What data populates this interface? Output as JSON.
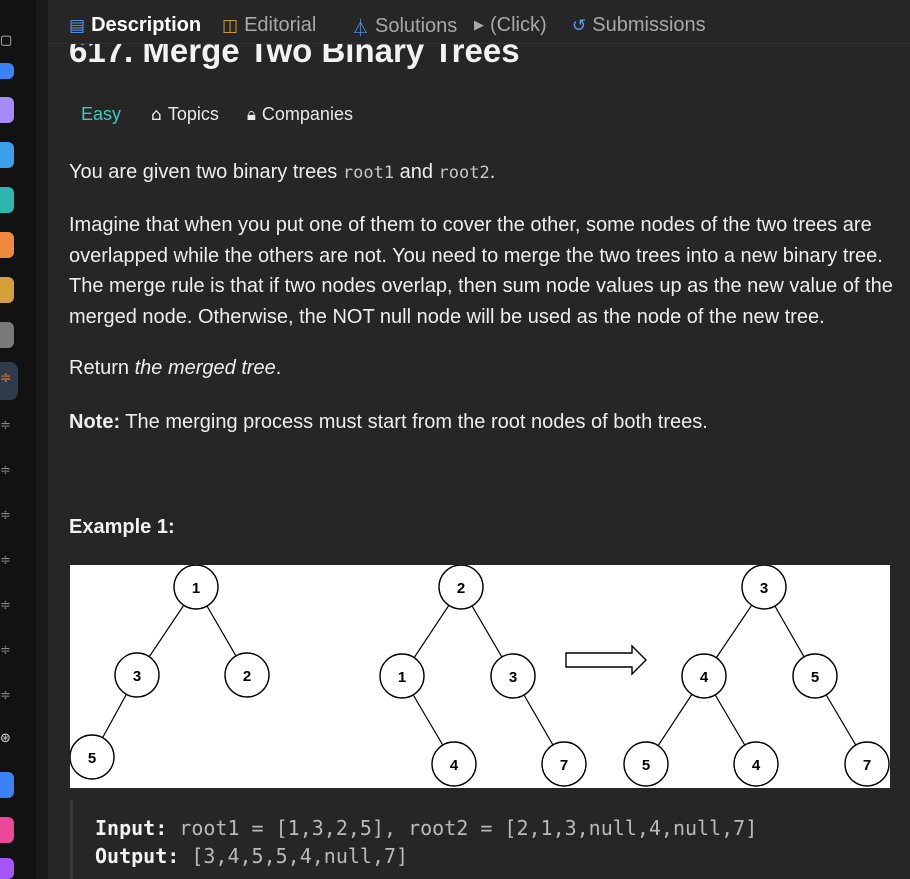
{
  "tabs": [
    {
      "label": "Description",
      "icon": "description-icon"
    },
    {
      "label": "Editorial",
      "icon": "book-icon"
    },
    {
      "label": "Solutions",
      "icon": "flask-icon"
    },
    {
      "label": "(Click)",
      "icon": "play-icon"
    },
    {
      "label": "Submissions",
      "icon": "history-icon"
    }
  ],
  "problem": {
    "title": "617. Merge Two Binary Trees",
    "difficulty": "Easy",
    "topics_label": "Topics",
    "companies_label": "Companies",
    "p1_prefix": "You are given two binary trees ",
    "p1_code1": "root1",
    "p1_mid": " and ",
    "p1_code2": "root2",
    "p1_end": ".",
    "p2": "Imagine that when you put one of them to cover the other, some nodes of the two trees are overlapped while the others are not. You need to merge the two trees into a new binary tree. The merge rule is that if two nodes overlap, then sum node values up as the new value of the merged node. Otherwise, the NOT null node will be used as the node of the new tree.",
    "p3_prefix": "Return ",
    "p3_em": "the merged tree",
    "p3_end": ".",
    "note_label": "Note:",
    "note_text": " The merging process must start from the root nodes of both trees."
  },
  "example1": {
    "title": "Example 1:",
    "input_label": "Input:",
    "input_value": " root1 = [1,3,2,5], root2 = [2,1,3,null,4,null,7]",
    "output_label": "Output:",
    "output_value": " [3,4,5,5,4,null,7]",
    "tree1_nodes": [
      "1",
      "3",
      "2",
      "5"
    ],
    "tree2_nodes": [
      "2",
      "1",
      "3",
      "4",
      "7"
    ],
    "merged_nodes": [
      "3",
      "4",
      "5",
      "5",
      "4",
      "7"
    ]
  },
  "colors": {
    "easy": "#46c6c2",
    "panel_bg": "#262626",
    "text": "#eeeeee"
  }
}
